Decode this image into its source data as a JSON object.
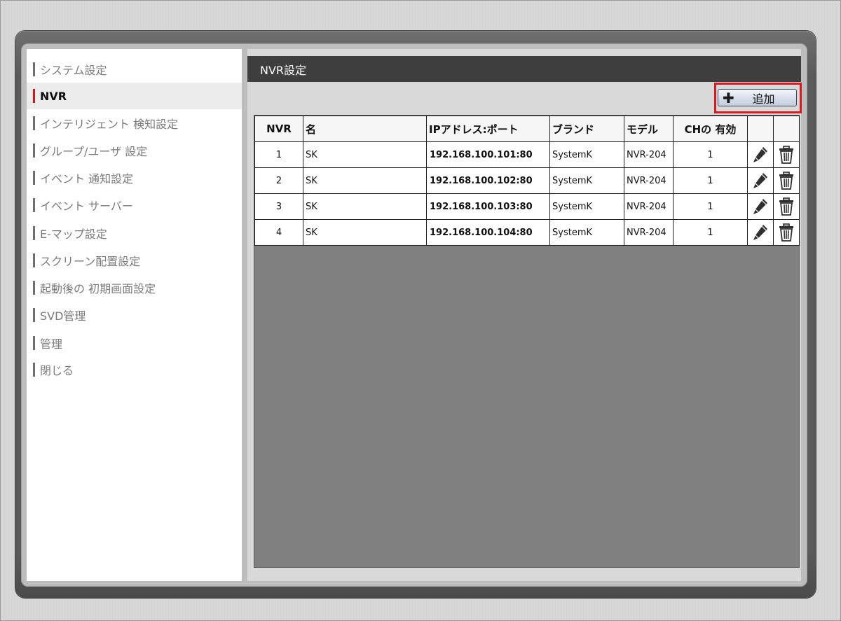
{
  "sidebar": {
    "items": [
      {
        "label": "システム設定",
        "active": false
      },
      {
        "label": "NVR",
        "active": true
      },
      {
        "label": "インテリジェント 検知設定",
        "active": false
      },
      {
        "label": "グループ/ユーザ 設定",
        "active": false
      },
      {
        "label": "イベント 通知設定",
        "active": false
      },
      {
        "label": "イベント サーバー",
        "active": false
      },
      {
        "label": "E-マップ設定",
        "active": false
      },
      {
        "label": "スクリーン配置設定",
        "active": false
      },
      {
        "label": "起動後の 初期画面設定",
        "active": false
      },
      {
        "label": "SVD管理",
        "active": false
      },
      {
        "label": "管理",
        "active": false
      },
      {
        "label": "閉じる",
        "active": false
      }
    ]
  },
  "main": {
    "title": "NVR設定",
    "add_button": {
      "icon": "plus-icon",
      "label": "追加"
    },
    "table": {
      "columns": [
        "NVR",
        "名",
        "IPアドレス:ポート",
        "ブランド",
        "モデル",
        "CHの 有効"
      ],
      "rows": [
        {
          "nvr": "1",
          "name": "SK",
          "ip": "192.168.100.101:80",
          "brand": "SystemK",
          "model": "NVR-204",
          "ch": "1"
        },
        {
          "nvr": "2",
          "name": "SK",
          "ip": "192.168.100.102:80",
          "brand": "SystemK",
          "model": "NVR-204",
          "ch": "1"
        },
        {
          "nvr": "3",
          "name": "SK",
          "ip": "192.168.100.103:80",
          "brand": "SystemK",
          "model": "NVR-204",
          "ch": "1"
        },
        {
          "nvr": "4",
          "name": "SK",
          "ip": "192.168.100.104:80",
          "brand": "SystemK",
          "model": "NVR-204",
          "ch": "1"
        }
      ],
      "row_actions": [
        "pencil-icon",
        "trash-icon"
      ]
    }
  },
  "colors": {
    "active_marker": "#d4161b",
    "highlight_border": "#d51c22",
    "header_bar": "#3e3e3e",
    "table_area": "#808080"
  }
}
